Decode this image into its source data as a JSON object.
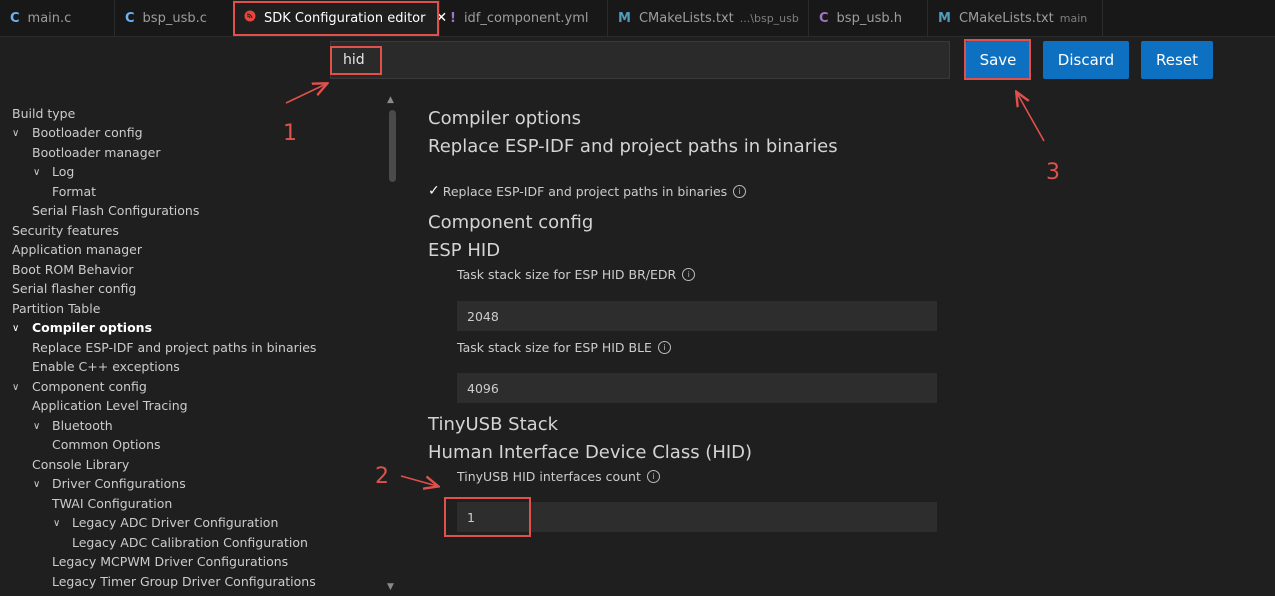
{
  "tabs": [
    {
      "icon": "C",
      "label": "main.c",
      "sub": ""
    },
    {
      "icon": "C",
      "label": "bsp_usb.c",
      "sub": ""
    },
    {
      "icon": "esp",
      "label": "SDK Configuration editor",
      "sub": "",
      "active": true
    },
    {
      "icon": "!",
      "label": "idf_component.yml",
      "sub": ""
    },
    {
      "icon": "M",
      "label": "CMakeLists.txt",
      "sub": "...\\bsp_usb"
    },
    {
      "icon": "C",
      "label": "bsp_usb.h",
      "sub": ""
    },
    {
      "icon": "M",
      "label": "CMakeLists.txt",
      "sub": "main"
    }
  ],
  "close_glyph": "✕",
  "search": {
    "value": "hid"
  },
  "buttons": {
    "save": "Save",
    "discard": "Discard",
    "reset": "Reset"
  },
  "tree": [
    {
      "label": "Build type",
      "level": 0,
      "chevron": false
    },
    {
      "label": "Bootloader config",
      "level": 0,
      "chevron": true
    },
    {
      "label": "Bootloader manager",
      "level": 1,
      "chevron": false
    },
    {
      "label": "Log",
      "level": 1,
      "chevron": true
    },
    {
      "label": "Format",
      "level": 2,
      "chevron": false
    },
    {
      "label": "Serial Flash Configurations",
      "level": 1,
      "chevron": false
    },
    {
      "label": "Security features",
      "level": 0,
      "chevron": false
    },
    {
      "label": "Application manager",
      "level": 0,
      "chevron": false
    },
    {
      "label": "Boot ROM Behavior",
      "level": 0,
      "chevron": false
    },
    {
      "label": "Serial flasher config",
      "level": 0,
      "chevron": false
    },
    {
      "label": "Partition Table",
      "level": 0,
      "chevron": false
    },
    {
      "label": "Compiler options",
      "level": 0,
      "chevron": true,
      "bold": true
    },
    {
      "label": "Replace ESP-IDF and project paths in binaries",
      "level": 1,
      "chevron": false
    },
    {
      "label": "Enable C++ exceptions",
      "level": 1,
      "chevron": false
    },
    {
      "label": "Component config",
      "level": 0,
      "chevron": true
    },
    {
      "label": "Application Level Tracing",
      "level": 1,
      "chevron": false
    },
    {
      "label": "Bluetooth",
      "level": 1,
      "chevron": true
    },
    {
      "label": "Common Options",
      "level": 2,
      "chevron": false
    },
    {
      "label": "Console Library",
      "level": 1,
      "chevron": false
    },
    {
      "label": "Driver Configurations",
      "level": 1,
      "chevron": true
    },
    {
      "label": "TWAI Configuration",
      "level": 2,
      "chevron": false
    },
    {
      "label": "Legacy ADC Driver Configuration",
      "level": 2,
      "chevron": true
    },
    {
      "label": "Legacy ADC Calibration Configuration",
      "level": 3,
      "chevron": false
    },
    {
      "label": "Legacy MCPWM Driver Configurations",
      "level": 2,
      "chevron": false
    },
    {
      "label": "Legacy Timer Group Driver Configurations",
      "level": 2,
      "chevron": false
    }
  ],
  "content": {
    "compiler_options": "Compiler options",
    "replace_paths_heading": "Replace ESP-IDF and project paths in binaries",
    "replace_paths_checkbox": "Replace ESP-IDF and project paths in binaries",
    "component_config": "Component config",
    "esp_hid": "ESP HID",
    "bredr_label": "Task stack size for ESP HID BR/EDR",
    "bredr_value": "2048",
    "ble_label": "Task stack size for ESP HID BLE",
    "ble_value": "4096",
    "tinyusb_stack": "TinyUSB Stack",
    "hid_class": "Human Interface Device Class (HID)",
    "hid_count_label": "TinyUSB HID interfaces count",
    "hid_count_value": "1"
  },
  "annotations": {
    "n1": "1",
    "n2": "2",
    "n3": "3"
  },
  "colors": {
    "accent": "#0e70c0",
    "annotation": "#e0514c",
    "background": "#1f1f1f"
  }
}
